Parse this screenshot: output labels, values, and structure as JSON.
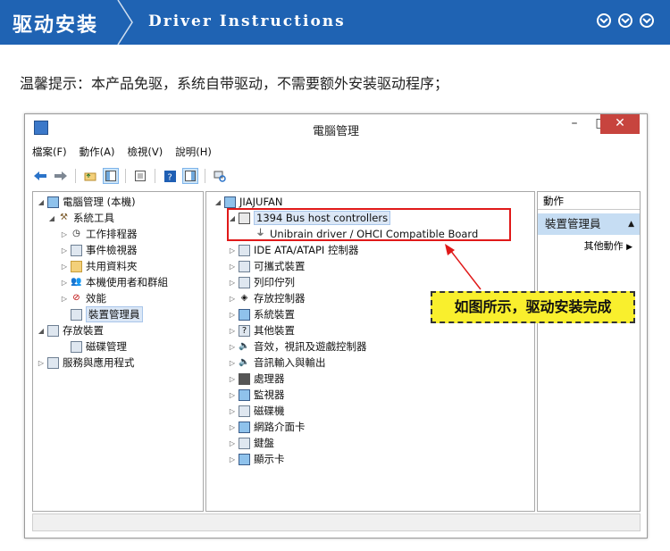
{
  "banner": {
    "title_cn": "驱动安装",
    "title_en": "Driver Instructions",
    "icons": [
      "chevron-down-icon",
      "chevron-down-icon",
      "chevron-down-icon"
    ]
  },
  "hint": "温馨提示：本产品免驱，系统自带驱动，不需要额外安装驱动程序；",
  "window": {
    "title": "電腦管理",
    "minimize": "–",
    "maximize": "□",
    "close": "✕",
    "menu": [
      "檔案(F)",
      "動作(A)",
      "檢視(V)",
      "說明(H)"
    ],
    "left_tree": [
      {
        "label": "電腦管理 (本機)",
        "icon": "computer-icon"
      },
      {
        "label": "系統工具",
        "icon": "tools-icon",
        "twisty": "◢"
      },
      {
        "label": "工作排程器",
        "icon": "clock-icon",
        "twisty": "▷"
      },
      {
        "label": "事件檢視器",
        "icon": "event-viewer-icon",
        "twisty": "▷"
      },
      {
        "label": "共用資料夾",
        "icon": "shared-folder-icon",
        "twisty": "▷"
      },
      {
        "label": "本機使用者和群組",
        "icon": "users-icon",
        "twisty": "▷"
      },
      {
        "label": "效能",
        "icon": "performance-icon",
        "twisty": "▷"
      },
      {
        "label": "裝置管理員",
        "icon": "device-manager-icon",
        "twisty": ""
      },
      {
        "label": "存放裝置",
        "icon": "storage-icon",
        "twisty": "◢"
      },
      {
        "label": "磁碟管理",
        "icon": "disk-icon",
        "twisty": ""
      },
      {
        "label": "服務與應用程式",
        "icon": "services-icon",
        "twisty": "▷"
      }
    ],
    "device_tree": {
      "root": "JIAJUFAN",
      "expanded_category": "1394 Bus host controllers",
      "expanded_child": "Unibrain driver / OHCI Compatible Board",
      "categories": [
        "IDE ATA/ATAPI 控制器",
        "可攜式裝置",
        "列印佇列",
        "存放控制器",
        "系統裝置",
        "其他裝置",
        "音效，視訊及遊戲控制器",
        "音訊輸入與輸出",
        "處理器",
        "監視器",
        "磁碟機",
        "網路介面卡",
        "鍵盤",
        "顯示卡"
      ]
    },
    "actions": {
      "header": "動作",
      "item": "裝置管理員",
      "sub": "其他動作"
    }
  },
  "callout": "如图所示，驱动安装完成",
  "colors": {
    "banner": "#1f63b3",
    "callout": "#f9ef2d",
    "highlight_box": "#e01919"
  }
}
